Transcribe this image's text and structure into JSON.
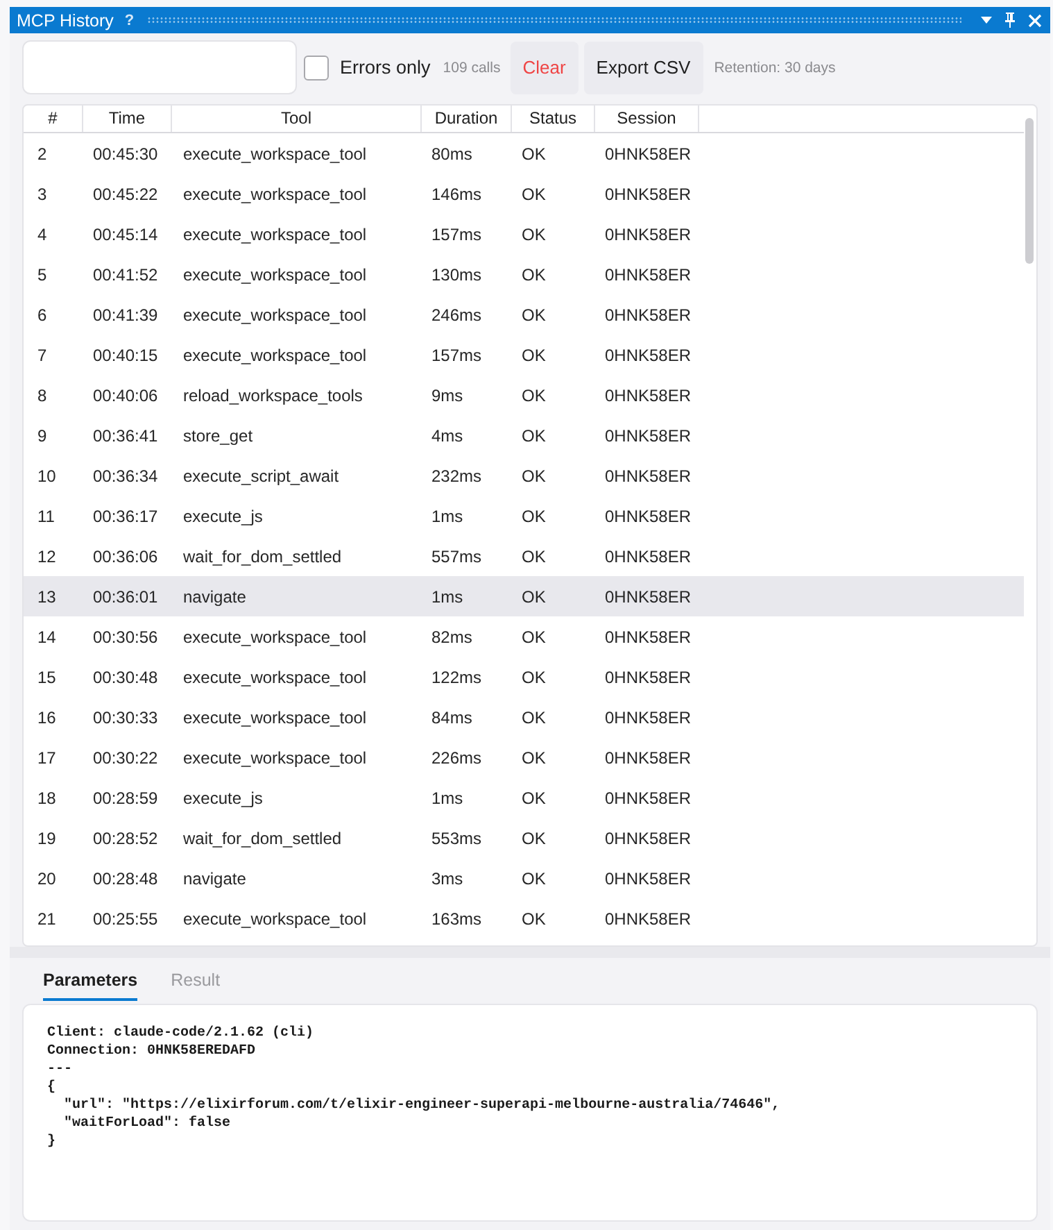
{
  "window": {
    "title": "MCP History",
    "help": "?"
  },
  "toolbar": {
    "errors_only": {
      "label": "Errors only",
      "checked": false
    },
    "count": "109 calls",
    "buttons": [
      {
        "label": "Clear",
        "kind": "clear"
      },
      {
        "label": "Export CSV",
        "kind": "export"
      }
    ],
    "retention": "Retention: 30 days"
  },
  "table": {
    "columns": [
      "#",
      "Time",
      "Tool",
      "Duration",
      "Status",
      "Session"
    ],
    "rows": [
      {
        "cells": [
          "2",
          "00:45:30",
          "execute_workspace_tool",
          "80ms",
          "OK",
          "0HNK58ER"
        ],
        "selected": false
      },
      {
        "cells": [
          "3",
          "00:45:22",
          "execute_workspace_tool",
          "146ms",
          "OK",
          "0HNK58ER"
        ],
        "selected": false
      },
      {
        "cells": [
          "4",
          "00:45:14",
          "execute_workspace_tool",
          "157ms",
          "OK",
          "0HNK58ER"
        ],
        "selected": false
      },
      {
        "cells": [
          "5",
          "00:41:52",
          "execute_workspace_tool",
          "130ms",
          "OK",
          "0HNK58ER"
        ],
        "selected": false
      },
      {
        "cells": [
          "6",
          "00:41:39",
          "execute_workspace_tool",
          "246ms",
          "OK",
          "0HNK58ER"
        ],
        "selected": false
      },
      {
        "cells": [
          "7",
          "00:40:15",
          "execute_workspace_tool",
          "157ms",
          "OK",
          "0HNK58ER"
        ],
        "selected": false
      },
      {
        "cells": [
          "8",
          "00:40:06",
          "reload_workspace_tools",
          "9ms",
          "OK",
          "0HNK58ER"
        ],
        "selected": false
      },
      {
        "cells": [
          "9",
          "00:36:41",
          "store_get",
          "4ms",
          "OK",
          "0HNK58ER"
        ],
        "selected": false
      },
      {
        "cells": [
          "10",
          "00:36:34",
          "execute_script_await",
          "232ms",
          "OK",
          "0HNK58ER"
        ],
        "selected": false
      },
      {
        "cells": [
          "11",
          "00:36:17",
          "execute_js",
          "1ms",
          "OK",
          "0HNK58ER"
        ],
        "selected": false
      },
      {
        "cells": [
          "12",
          "00:36:06",
          "wait_for_dom_settled",
          "557ms",
          "OK",
          "0HNK58ER"
        ],
        "selected": false
      },
      {
        "cells": [
          "13",
          "00:36:01",
          "navigate",
          "1ms",
          "OK",
          "0HNK58ER"
        ],
        "selected": true
      },
      {
        "cells": [
          "14",
          "00:30:56",
          "execute_workspace_tool",
          "82ms",
          "OK",
          "0HNK58ER"
        ],
        "selected": false
      },
      {
        "cells": [
          "15",
          "00:30:48",
          "execute_workspace_tool",
          "122ms",
          "OK",
          "0HNK58ER"
        ],
        "selected": false
      },
      {
        "cells": [
          "16",
          "00:30:33",
          "execute_workspace_tool",
          "84ms",
          "OK",
          "0HNK58ER"
        ],
        "selected": false
      },
      {
        "cells": [
          "17",
          "00:30:22",
          "execute_workspace_tool",
          "226ms",
          "OK",
          "0HNK58ER"
        ],
        "selected": false
      },
      {
        "cells": [
          "18",
          "00:28:59",
          "execute_js",
          "1ms",
          "OK",
          "0HNK58ER"
        ],
        "selected": false
      },
      {
        "cells": [
          "19",
          "00:28:52",
          "wait_for_dom_settled",
          "553ms",
          "OK",
          "0HNK58ER"
        ],
        "selected": false
      },
      {
        "cells": [
          "20",
          "00:28:48",
          "navigate",
          "3ms",
          "OK",
          "0HNK58ER"
        ],
        "selected": false
      },
      {
        "cells": [
          "21",
          "00:25:55",
          "execute_workspace_tool",
          "163ms",
          "OK",
          "0HNK58ER"
        ],
        "selected": false
      }
    ]
  },
  "detail": {
    "tabs": [
      {
        "label": "Parameters",
        "selected": true
      },
      {
        "label": "Result",
        "selected": false
      }
    ],
    "lines": [
      "Client: claude-code/2.1.62 (cli)",
      "Connection: 0HNK58EREDAFD",
      "---",
      "{",
      "  \"url\": \"https://elixirforum.com/t/elixir-engineer-superapi-melbourne-australia/74646\",",
      "  \"waitForLoad\": false",
      "}"
    ]
  }
}
